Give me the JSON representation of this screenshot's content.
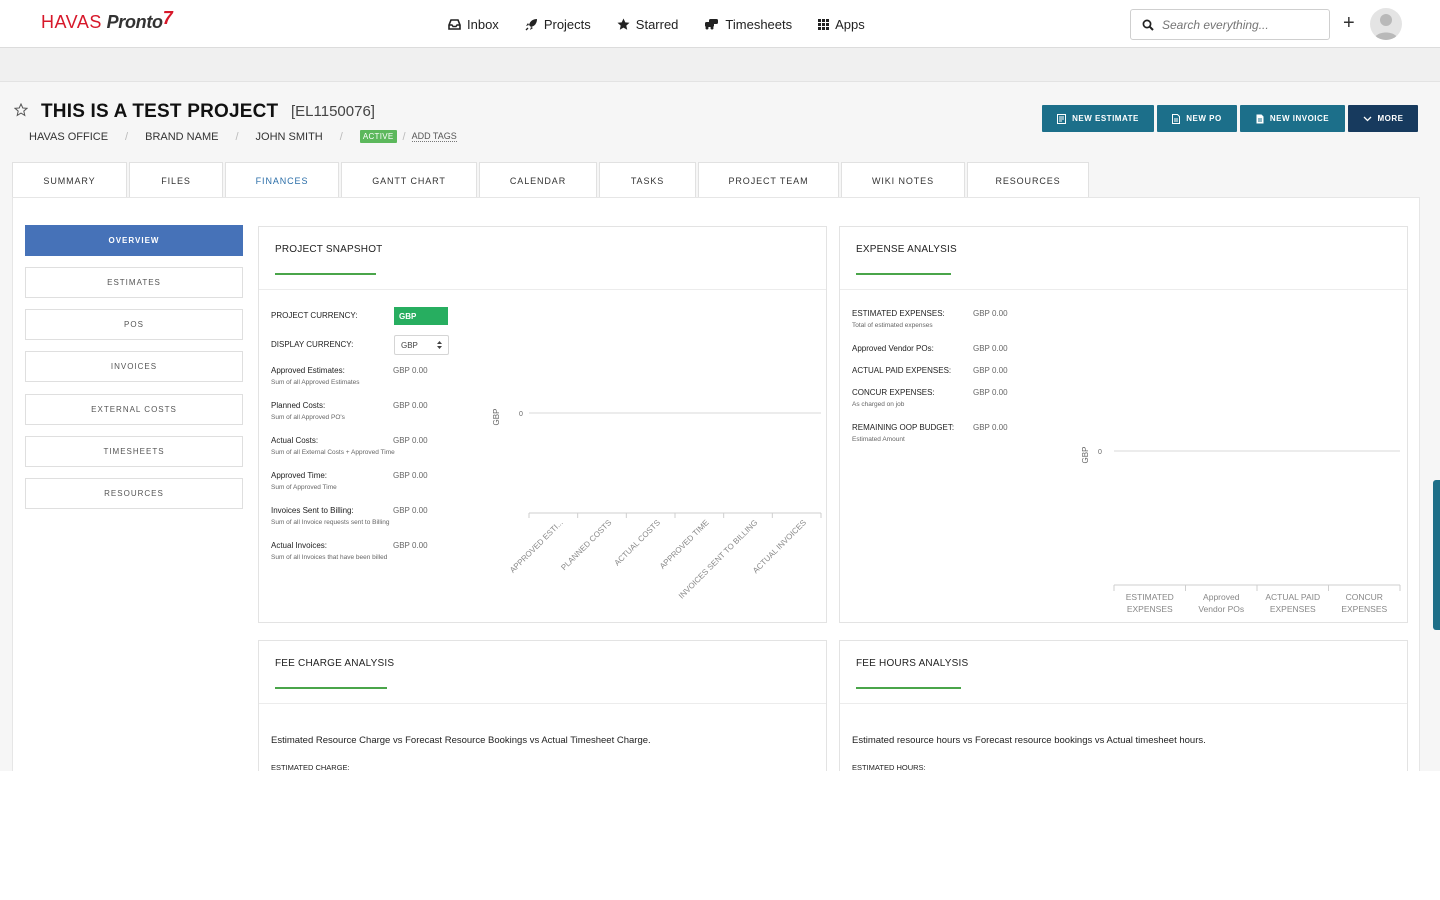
{
  "brand": {
    "havas": "HAVAS",
    "pronto": "Pronto",
    "bolt": "7"
  },
  "nav": {
    "items": [
      {
        "label": "Inbox",
        "icon": "inbox-icon"
      },
      {
        "label": "Projects",
        "icon": "rocket-icon"
      },
      {
        "label": "Starred",
        "icon": "star-icon"
      },
      {
        "label": "Timesheets",
        "icon": "cars-icon"
      },
      {
        "label": "Apps",
        "icon": "grid-icon"
      }
    ],
    "search_placeholder": "Search everything..."
  },
  "project": {
    "title": "THIS IS A TEST PROJECT",
    "code": "[EL1150076]",
    "office": "HAVAS OFFICE",
    "brand": "BRAND NAME",
    "owner": "JOHN SMITH",
    "status": "ACTIVE",
    "add_tags": "ADD TAGS"
  },
  "actions": [
    {
      "label": "NEW ESTIMATE"
    },
    {
      "label": "NEW PO"
    },
    {
      "label": "NEW INVOICE"
    },
    {
      "label": "MORE"
    }
  ],
  "tabs": [
    "SUMMARY",
    "FILES",
    "FINANCES",
    "GANTT CHART",
    "CALENDAR",
    "TASKS",
    "PROJECT TEAM",
    "WIKI NOTES",
    "RESOURCES"
  ],
  "active_tab": "FINANCES",
  "sidemenu": [
    "OVERVIEW",
    "ESTIMATES",
    "POS",
    "INVOICES",
    "EXTERNAL COSTS",
    "TIMESHEETS",
    "RESOURCES"
  ],
  "snapshot": {
    "title": "PROJECT SNAPSHOT",
    "project_currency_label": "PROJECT CURRENCY:",
    "project_currency": "GBP",
    "display_currency_label": "DISPLAY CURRENCY:",
    "display_currency": "GBP",
    "rows": [
      {
        "label": "Approved Estimates:",
        "sub": "Sum of all Approved Estimates",
        "value": "GBP 0.00"
      },
      {
        "label": "Planned Costs:",
        "sub": "Sum of all Approved PO's",
        "value": "GBP 0.00"
      },
      {
        "label": "Actual Costs:",
        "sub": "Sum of all External Costs + Approved Time",
        "value": "GBP 0.00"
      },
      {
        "label": "Approved Time:",
        "sub": "Sum of Approved Time",
        "value": "GBP 0.00"
      },
      {
        "label": "Invoices Sent to Billing:",
        "sub": "Sum of all Invoice requests sent to Billing",
        "value": "GBP 0.00"
      },
      {
        "label": "Actual Invoices:",
        "sub": "Sum of all Invoices that have been billed",
        "value": "GBP 0.00"
      }
    ]
  },
  "expense": {
    "title": "EXPENSE ANALYSIS",
    "rows": [
      {
        "label": "ESTIMATED EXPENSES:",
        "sub": "Total of estimated expenses",
        "value": "GBP 0.00"
      },
      {
        "label": "Approved Vendor POs:",
        "sub": "",
        "value": "GBP 0.00"
      },
      {
        "label": "ACTUAL PAID EXPENSES:",
        "sub": "",
        "value": "GBP 0.00"
      },
      {
        "label": "CONCUR EXPENSES:",
        "sub": "As charged on job",
        "value": "GBP 0.00"
      },
      {
        "label": "REMAINING OOP BUDGET:",
        "sub": "Estimated Amount",
        "value": "GBP 0.00"
      }
    ]
  },
  "fee_charge": {
    "title": "FEE CHARGE ANALYSIS",
    "description": "Estimated Resource Charge vs Forecast Resource Bookings vs Actual Timesheet Charge.",
    "first_label": "ESTIMATED CHARGE:"
  },
  "fee_hours": {
    "title": "FEE HOURS ANALYSIS",
    "description": "Estimated resource hours vs Forecast resource bookings vs Actual timesheet hours.",
    "first_label": "ESTIMATED HOURS:"
  },
  "chart_data": [
    {
      "type": "bar",
      "ylabel": "GBP",
      "y_ticks": [
        "0"
      ],
      "categories": [
        "APPROVED ESTI...",
        "PLANNED COSTS",
        "ACTUAL COSTS",
        "APPROVED TIME",
        "INVOICES SENT TO BILLING",
        "ACTUAL INVOICES"
      ],
      "values": [
        0,
        0,
        0,
        0,
        0,
        0
      ]
    },
    {
      "type": "bar",
      "ylabel": "GBP",
      "y_ticks": [
        "0"
      ],
      "categories": [
        [
          "ESTIMATED",
          "EXPENSES"
        ],
        [
          "Approved",
          "Vendor POs"
        ],
        [
          "ACTUAL PAID",
          "EXPENSES"
        ],
        [
          "CONCUR",
          "EXPENSES"
        ]
      ],
      "values": [
        0,
        0,
        0,
        0
      ]
    }
  ]
}
